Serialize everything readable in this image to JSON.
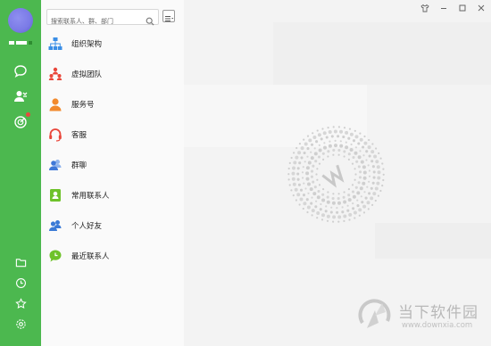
{
  "search": {
    "placeholder": "搜索联系人、群、部门"
  },
  "contacts": {
    "items": [
      {
        "label": "组织架构",
        "icon": "org-chart-icon",
        "color": "#3a8ee6"
      },
      {
        "label": "虚拟团队",
        "icon": "virtual-team-icon",
        "color": "#e9463a"
      },
      {
        "label": "服务号",
        "icon": "service-account-icon",
        "color": "#f28a2d"
      },
      {
        "label": "客服",
        "icon": "headset-icon",
        "color": "#e9463a"
      },
      {
        "label": "群聊",
        "icon": "group-chat-icon",
        "color": "#5d8fde"
      },
      {
        "label": "常用联系人",
        "icon": "frequent-contacts-icon",
        "color": "#6ec22a"
      },
      {
        "label": "个人好友",
        "icon": "friends-icon",
        "color": "#3a7ad6"
      },
      {
        "label": "最近联系人",
        "icon": "recent-contacts-icon",
        "color": "#6ec22a"
      }
    ]
  },
  "sidebar": {
    "accent": "#4cb84f",
    "icons": [
      "chat-icon",
      "contacts-icon",
      "radar-icon",
      "folder-icon",
      "clock-icon",
      "star-icon",
      "settings-icon"
    ]
  },
  "window": {
    "controls": [
      "skin-icon",
      "minimize-icon",
      "maximize-icon",
      "close-icon"
    ]
  },
  "watermark": {
    "title": "当下软件园",
    "url": "www.downxia.com"
  }
}
